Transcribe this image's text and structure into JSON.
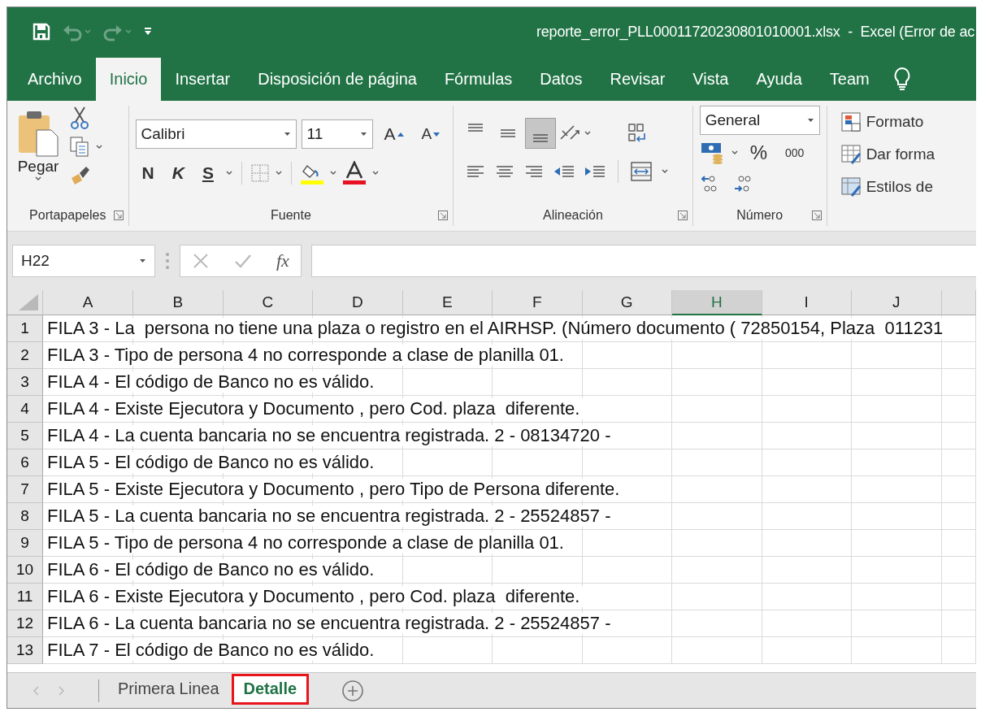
{
  "window": {
    "title": "reporte_error_PLL00011720230801010001.xlsx  -  Excel (Error de ac"
  },
  "quick_access": [
    {
      "kind": "save",
      "disabled": false
    },
    {
      "kind": "undo",
      "disabled": true
    },
    {
      "kind": "redo",
      "disabled": true
    },
    {
      "kind": "customize",
      "disabled": false
    }
  ],
  "ribbon_tabs": [
    {
      "label": "Archivo",
      "selected": false
    },
    {
      "label": "Inicio",
      "selected": true
    },
    {
      "label": "Insertar",
      "selected": false
    },
    {
      "label": "Disposición de página",
      "selected": false
    },
    {
      "label": "Fórmulas",
      "selected": false
    },
    {
      "label": "Datos",
      "selected": false
    },
    {
      "label": "Revisar",
      "selected": false
    },
    {
      "label": "Vista",
      "selected": false
    },
    {
      "label": "Ayuda",
      "selected": false
    },
    {
      "label": "Team",
      "selected": false
    }
  ],
  "ribbon": {
    "clipboard": {
      "paste_label": "Pegar",
      "group_label": "Portapapeles"
    },
    "font": {
      "name": "Calibri",
      "size": "11",
      "grow": "A",
      "shrink": "A",
      "bold": "N",
      "italic": "K",
      "underline": "S",
      "group_label": "Fuente"
    },
    "alignment": {
      "vertical_align": [
        {
          "kind": "top",
          "selected": false
        },
        {
          "kind": "middle",
          "selected": false
        },
        {
          "kind": "bottom",
          "selected": true
        }
      ],
      "group_label": "Alineación"
    },
    "number": {
      "format": "General",
      "percent": "%",
      "thousands": "000",
      "group_label": "Número"
    },
    "styles": {
      "items": [
        "Formato",
        "Dar forma",
        "Estilos de"
      ]
    }
  },
  "formula_bar": {
    "name_box": "H22",
    "fx": "fx"
  },
  "sheet": {
    "columns": [
      {
        "label": "A",
        "selected": false
      },
      {
        "label": "B",
        "selected": false
      },
      {
        "label": "C",
        "selected": false
      },
      {
        "label": "D",
        "selected": false
      },
      {
        "label": "E",
        "selected": false
      },
      {
        "label": "F",
        "selected": false
      },
      {
        "label": "G",
        "selected": false
      },
      {
        "label": "H",
        "selected": true
      },
      {
        "label": "I",
        "selected": false
      },
      {
        "label": "J",
        "selected": false
      }
    ],
    "rows": [
      {
        "number": "1",
        "text": "FILA 3 - La  persona no tiene una plaza o registro en el AIRHSP. (Número documento ( 72850154, Plaza  011231"
      },
      {
        "number": "2",
        "text": "FILA 3 - Tipo de persona 4 no corresponde a clase de planilla 01."
      },
      {
        "number": "3",
        "text": "FILA 4 - El código de Banco no es válido."
      },
      {
        "number": "4",
        "text": "FILA 4 - Existe Ejecutora y Documento , pero Cod. plaza  diferente."
      },
      {
        "number": "5",
        "text": "FILA 4 - La cuenta bancaria no se encuentra registrada. 2 - 08134720 -"
      },
      {
        "number": "6",
        "text": "FILA 5 - El código de Banco no es válido."
      },
      {
        "number": "7",
        "text": "FILA 5 - Existe Ejecutora y Documento , pero Tipo de Persona diferente."
      },
      {
        "number": "8",
        "text": "FILA 5 - La cuenta bancaria no se encuentra registrada. 2 - 25524857 -"
      },
      {
        "number": "9",
        "text": "FILA 5 - Tipo de persona 4 no corresponde a clase de planilla 01."
      },
      {
        "number": "10",
        "text": "FILA 6 - El código de Banco no es válido."
      },
      {
        "number": "11",
        "text": "FILA 6 - Existe Ejecutora y Documento , pero Cod. plaza  diferente."
      },
      {
        "number": "12",
        "text": "FILA 6 - La cuenta bancaria no se encuentra registrada. 2 - 25524857 -"
      },
      {
        "number": "13",
        "text": "FILA 7 - El código de Banco no es válido."
      }
    ]
  },
  "sheet_tabs": [
    {
      "label": "Primera Linea",
      "selected": false,
      "highlighted": false
    },
    {
      "label": "Detalle",
      "selected": true,
      "highlighted": true
    }
  ]
}
